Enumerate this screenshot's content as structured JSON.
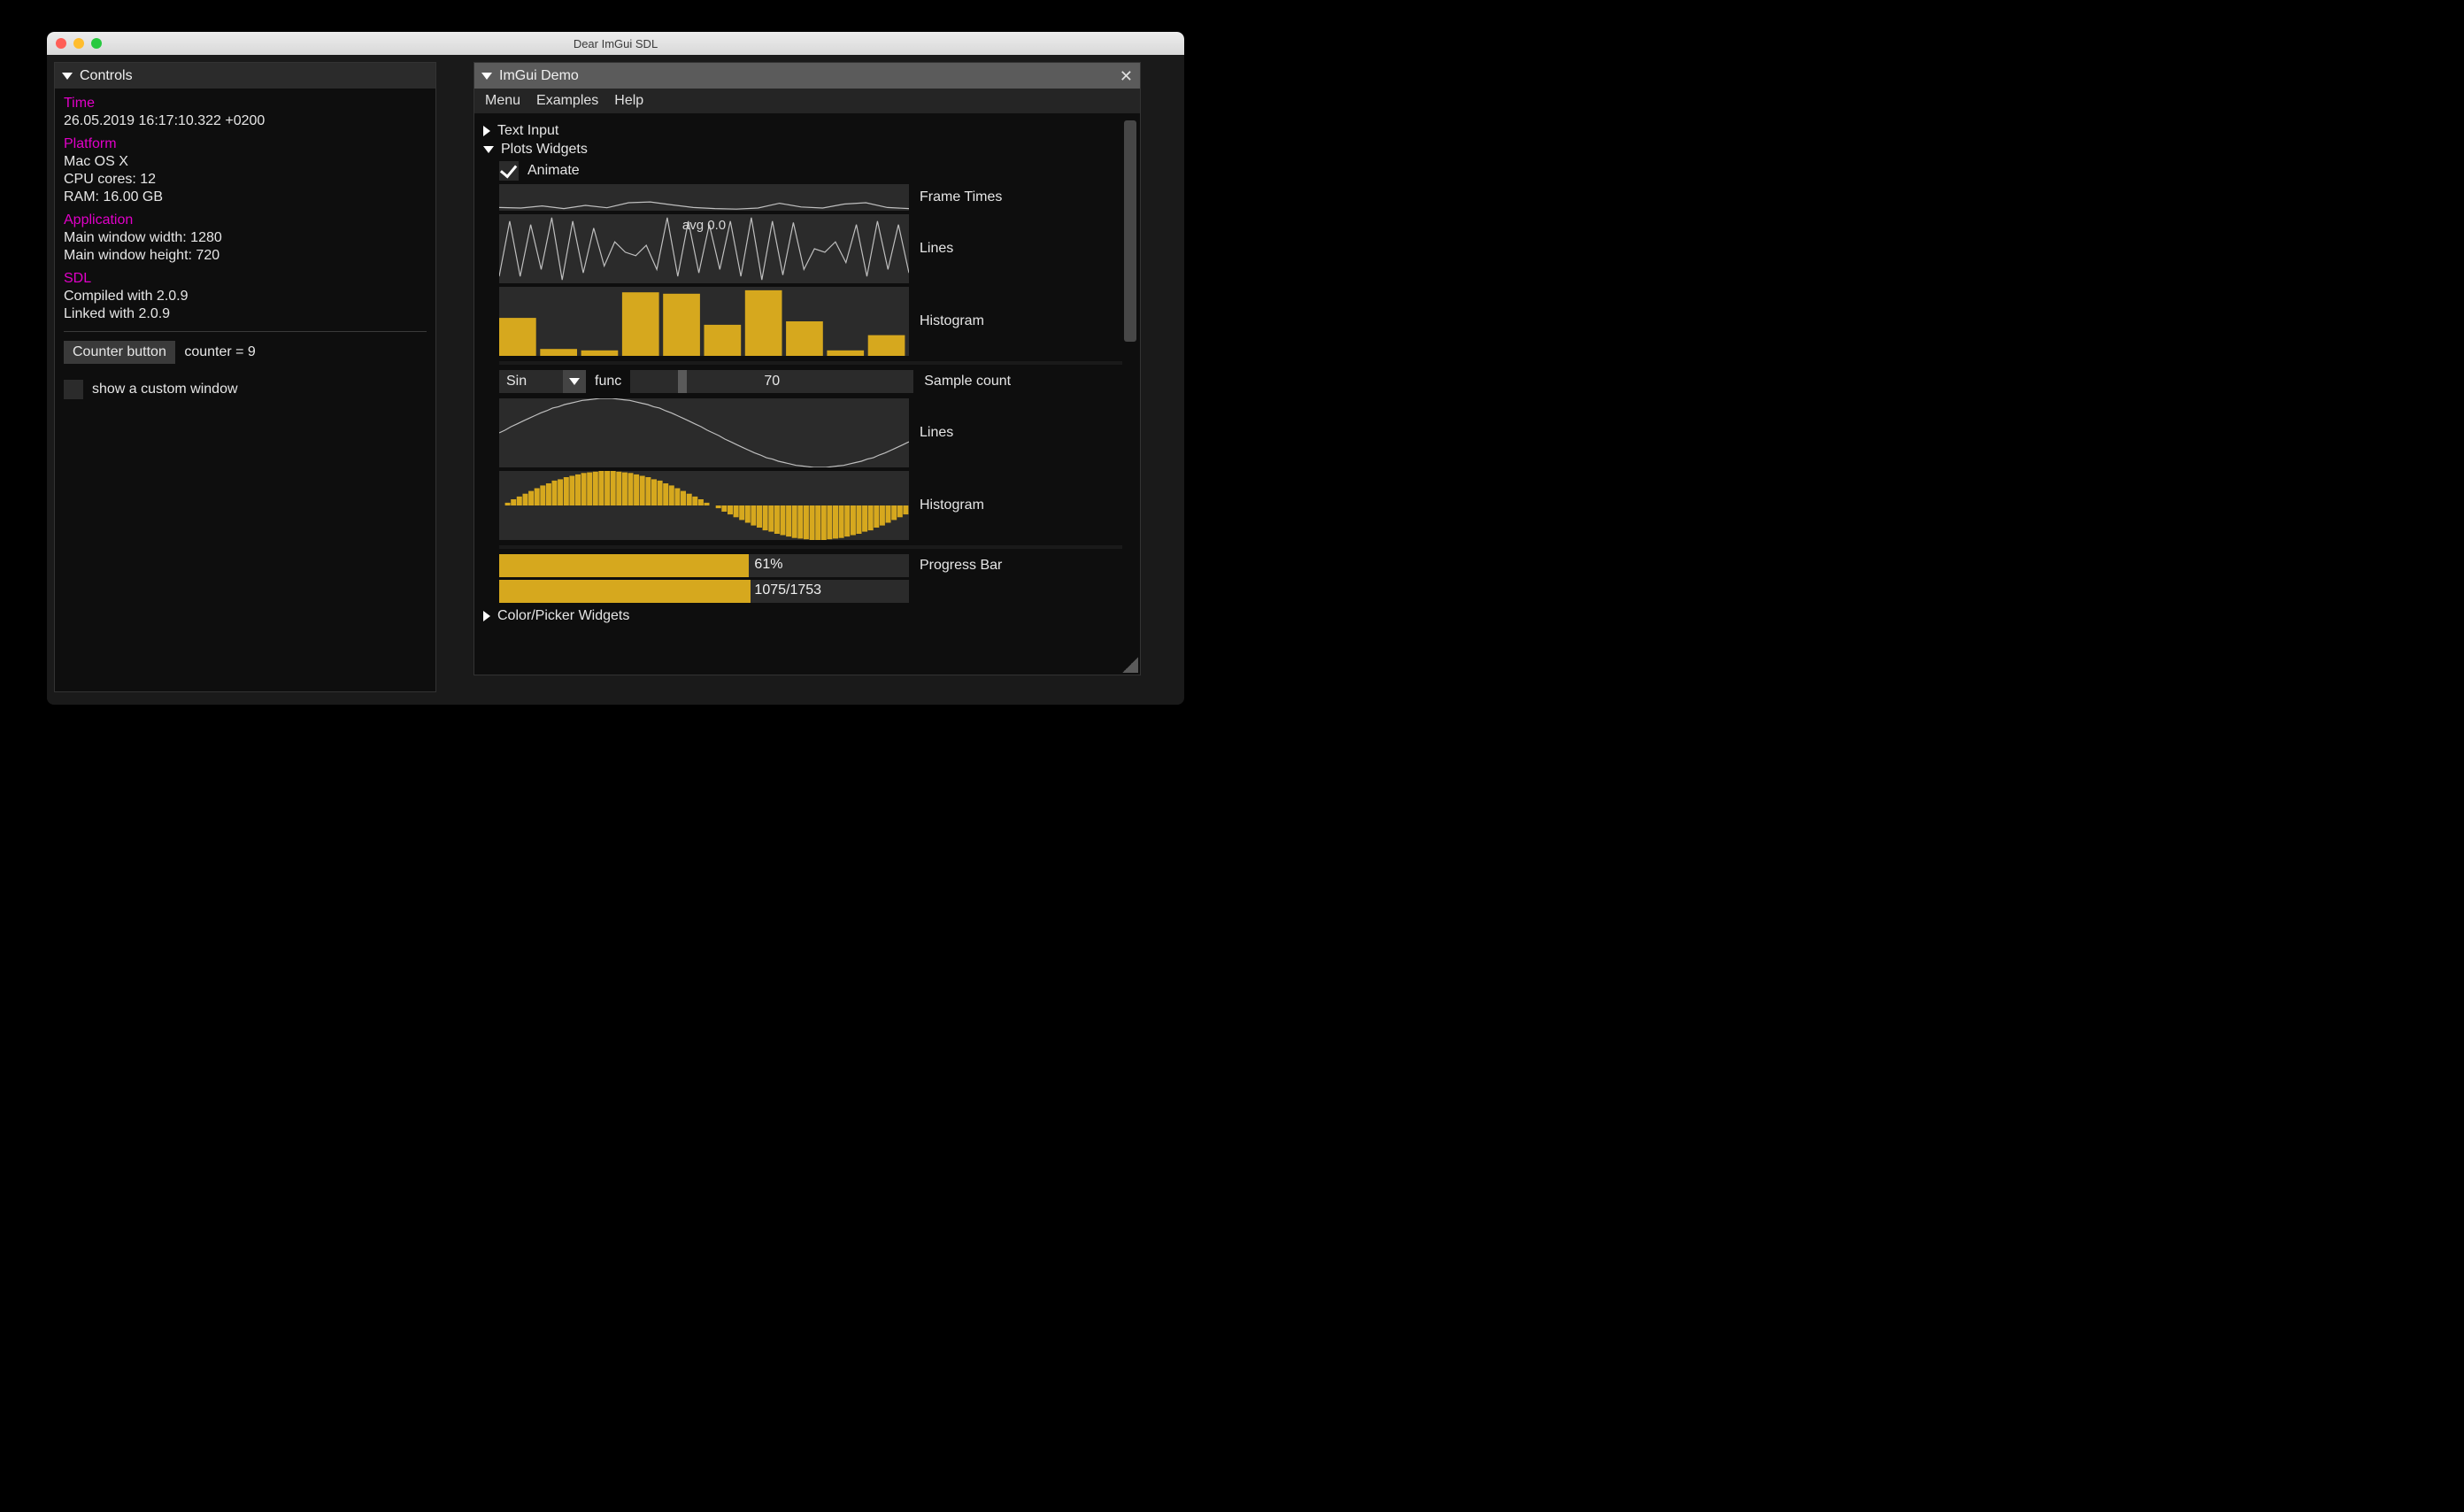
{
  "window": {
    "title": "Dear ImGui SDL"
  },
  "controls": {
    "title": "Controls",
    "time_label": "Time",
    "time_value": "26.05.2019 16:17:10.322 +0200",
    "platform_label": "Platform",
    "platform_os": "Mac OS X",
    "platform_cpu": "CPU cores: 12",
    "platform_ram": "RAM: 16.00 GB",
    "app_label": "Application",
    "app_width": "Main window width: 1280",
    "app_height": "Main window height: 720",
    "sdl_label": "SDL",
    "sdl_compiled": "Compiled with 2.0.9",
    "sdl_linked": "Linked with 2.0.9",
    "counter_button": "Counter button",
    "counter_text": "counter = 9",
    "show_custom": "show a custom window"
  },
  "demo": {
    "title": "ImGui Demo",
    "menu": {
      "menu": "Menu",
      "examples": "Examples",
      "help": "Help"
    },
    "text_input": "Text Input",
    "plots_widgets": "Plots Widgets",
    "animate": "Animate",
    "frame_times": "Frame Times",
    "lines": "Lines",
    "lines_avg": "avg 0.0",
    "histogram": "Histogram",
    "func_combo_value": "Sin",
    "func_label": "func",
    "sample_count_value": "70",
    "sample_count_label": "Sample count",
    "lines2": "Lines",
    "histogram2": "Histogram",
    "progress_pct": "61%",
    "progress_bar_label": "Progress Bar",
    "progress_frac": "1075/1753",
    "color_picker": "Color/Picker Widgets"
  },
  "chart_data": [
    {
      "type": "line",
      "title": "Frame Times",
      "x": [
        0,
        1,
        2,
        3,
        4,
        5,
        6,
        7,
        8,
        9,
        10,
        11,
        12,
        13,
        14,
        15,
        16,
        17,
        18,
        19
      ],
      "values": [
        0.12,
        0.1,
        0.18,
        0.08,
        0.2,
        0.11,
        0.3,
        0.33,
        0.22,
        0.12,
        0.08,
        0.06,
        0.1,
        0.28,
        0.14,
        0.1,
        0.25,
        0.3,
        0.12,
        0.08
      ],
      "ylim": [
        0,
        1
      ]
    },
    {
      "type": "line",
      "title": "Lines (avg 0.0)",
      "x": [
        0,
        1,
        2,
        3,
        4,
        5,
        6,
        7,
        8,
        9,
        10,
        11,
        12,
        13,
        14,
        15,
        16,
        17,
        18,
        19,
        20,
        21,
        22,
        23,
        24,
        25,
        26,
        27,
        28,
        29,
        30,
        31,
        32,
        33,
        34,
        35,
        36,
        37,
        38,
        39
      ],
      "values": [
        0.1,
        0.9,
        0.1,
        0.85,
        0.2,
        0.95,
        0.05,
        0.9,
        0.15,
        0.8,
        0.25,
        0.6,
        0.45,
        0.4,
        0.55,
        0.2,
        0.95,
        0.1,
        0.9,
        0.15,
        0.85,
        0.2,
        0.9,
        0.1,
        0.95,
        0.05,
        0.9,
        0.12,
        0.88,
        0.2,
        0.5,
        0.45,
        0.6,
        0.3,
        0.85,
        0.1,
        0.9,
        0.2,
        0.85,
        0.15
      ],
      "ylim": [
        0,
        1
      ]
    },
    {
      "type": "bar",
      "title": "Histogram",
      "categories": [
        0,
        1,
        2,
        3,
        4,
        5,
        6,
        7,
        8,
        9
      ],
      "values": [
        0.55,
        0.1,
        0.08,
        0.92,
        0.9,
        0.45,
        0.95,
        0.5,
        0.08,
        0.3
      ],
      "ylim": [
        0,
        1
      ]
    },
    {
      "type": "line",
      "title": "Lines (Sin)",
      "x": [
        0,
        1,
        2,
        3,
        4,
        5,
        6,
        7,
        8,
        9,
        10,
        11,
        12,
        13,
        14,
        15,
        16,
        17,
        18,
        19,
        20,
        21,
        22,
        23,
        24,
        25,
        26,
        27,
        28,
        29,
        30,
        31,
        32,
        33,
        34,
        35,
        36,
        37,
        38,
        39,
        40,
        41,
        42,
        43,
        44,
        45,
        46,
        47,
        48,
        49,
        50,
        51,
        52,
        53,
        54,
        55,
        56,
        57,
        58,
        59,
        60,
        61,
        62,
        63,
        64,
        65,
        66,
        67,
        68,
        69
      ],
      "values": [
        0.5,
        0.54,
        0.59,
        0.63,
        0.67,
        0.71,
        0.75,
        0.79,
        0.82,
        0.86,
        0.88,
        0.91,
        0.93,
        0.95,
        0.97,
        0.98,
        0.99,
        1.0,
        1.0,
        1.0,
        0.99,
        0.98,
        0.97,
        0.95,
        0.93,
        0.91,
        0.88,
        0.86,
        0.82,
        0.79,
        0.75,
        0.71,
        0.67,
        0.63,
        0.59,
        0.54,
        0.5,
        0.46,
        0.41,
        0.37,
        0.33,
        0.29,
        0.25,
        0.21,
        0.18,
        0.14,
        0.12,
        0.09,
        0.07,
        0.05,
        0.03,
        0.02,
        0.01,
        0.0,
        0.0,
        0.0,
        0.01,
        0.02,
        0.03,
        0.05,
        0.07,
        0.09,
        0.12,
        0.14,
        0.18,
        0.21,
        0.25,
        0.29,
        0.33,
        0.37
      ],
      "ylim": [
        0,
        1
      ]
    },
    {
      "type": "bar",
      "title": "Histogram (Sin)",
      "categories": [
        0,
        1,
        2,
        3,
        4,
        5,
        6,
        7,
        8,
        9,
        10,
        11,
        12,
        13,
        14,
        15,
        16,
        17,
        18,
        19,
        20,
        21,
        22,
        23,
        24,
        25,
        26,
        27,
        28,
        29,
        30,
        31,
        32,
        33,
        34,
        35,
        36,
        37,
        38,
        39,
        40,
        41,
        42,
        43,
        44,
        45,
        46,
        47,
        48,
        49,
        50,
        51,
        52,
        53,
        54,
        55,
        56,
        57,
        58,
        59,
        60,
        61,
        62,
        63,
        64,
        65,
        66,
        67,
        68,
        69
      ],
      "values": [
        0.0,
        0.04,
        0.09,
        0.13,
        0.17,
        0.21,
        0.25,
        0.29,
        0.32,
        0.36,
        0.38,
        0.41,
        0.43,
        0.45,
        0.47,
        0.48,
        0.49,
        0.5,
        0.5,
        0.5,
        0.49,
        0.48,
        0.47,
        0.45,
        0.43,
        0.41,
        0.38,
        0.36,
        0.32,
        0.29,
        0.25,
        0.21,
        0.17,
        0.13,
        0.09,
        0.04,
        0.0,
        -0.04,
        -0.09,
        -0.13,
        -0.17,
        -0.21,
        -0.25,
        -0.29,
        -0.32,
        -0.36,
        -0.38,
        -0.41,
        -0.43,
        -0.45,
        -0.47,
        -0.48,
        -0.49,
        -0.5,
        -0.5,
        -0.5,
        -0.49,
        -0.48,
        -0.47,
        -0.45,
        -0.43,
        -0.41,
        -0.38,
        -0.36,
        -0.32,
        -0.29,
        -0.25,
        -0.21,
        -0.17,
        -0.13
      ],
      "ylim": [
        -0.5,
        0.5
      ]
    }
  ],
  "progress": {
    "pct": 0.61,
    "num": 1075,
    "den": 1753
  }
}
